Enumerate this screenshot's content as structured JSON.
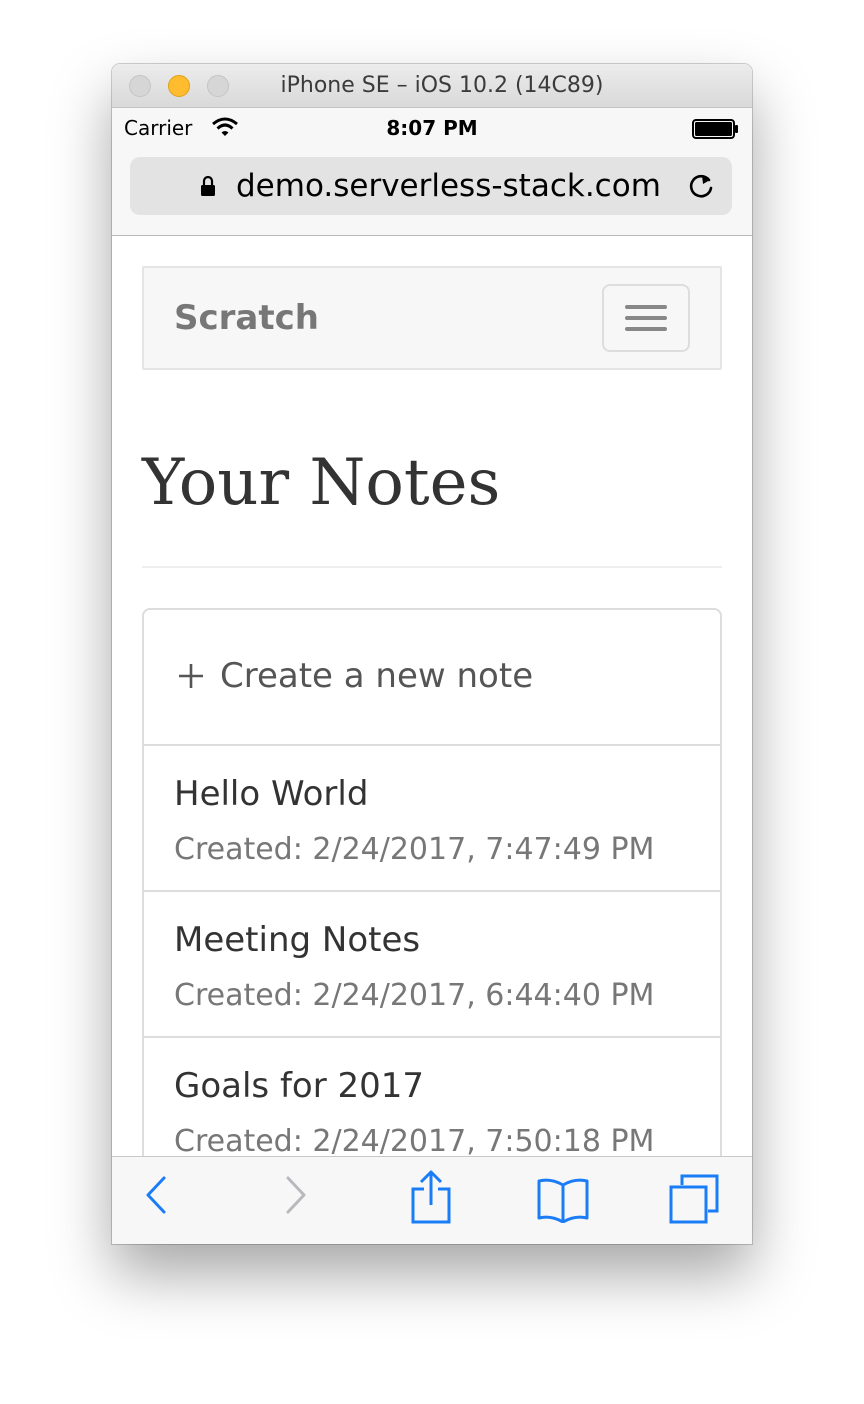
{
  "window": {
    "title": "iPhone SE – iOS 10.2 (14C89)"
  },
  "statusbar": {
    "carrier": "Carrier",
    "time": "8:07 PM"
  },
  "browser": {
    "url": "demo.serverless-stack.com"
  },
  "navbar": {
    "brand": "Scratch"
  },
  "page": {
    "title": "Your Notes",
    "create_label": "Create a new note",
    "notes": [
      {
        "title": "Hello World",
        "created": "Created: 2/24/2017, 7:47:49 PM"
      },
      {
        "title": "Meeting Notes",
        "created": "Created: 2/24/2017, 6:44:40 PM"
      },
      {
        "title": "Goals for 2017",
        "created": "Created: 2/24/2017, 7:50:18 PM"
      }
    ]
  },
  "colors": {
    "accent": "#1a7cf6",
    "disabled": "#b9b9bd",
    "navbar_bg": "#f7f7f7"
  },
  "icons": {
    "status": [
      "wifi-icon",
      "battery-icon"
    ],
    "urlbar": [
      "lock-icon",
      "reload-icon"
    ],
    "page": [
      "menu-icon",
      "plus-icon"
    ],
    "toolbar": [
      "back-icon",
      "forward-icon",
      "share-icon",
      "bookmarks-icon",
      "tabs-icon"
    ]
  }
}
